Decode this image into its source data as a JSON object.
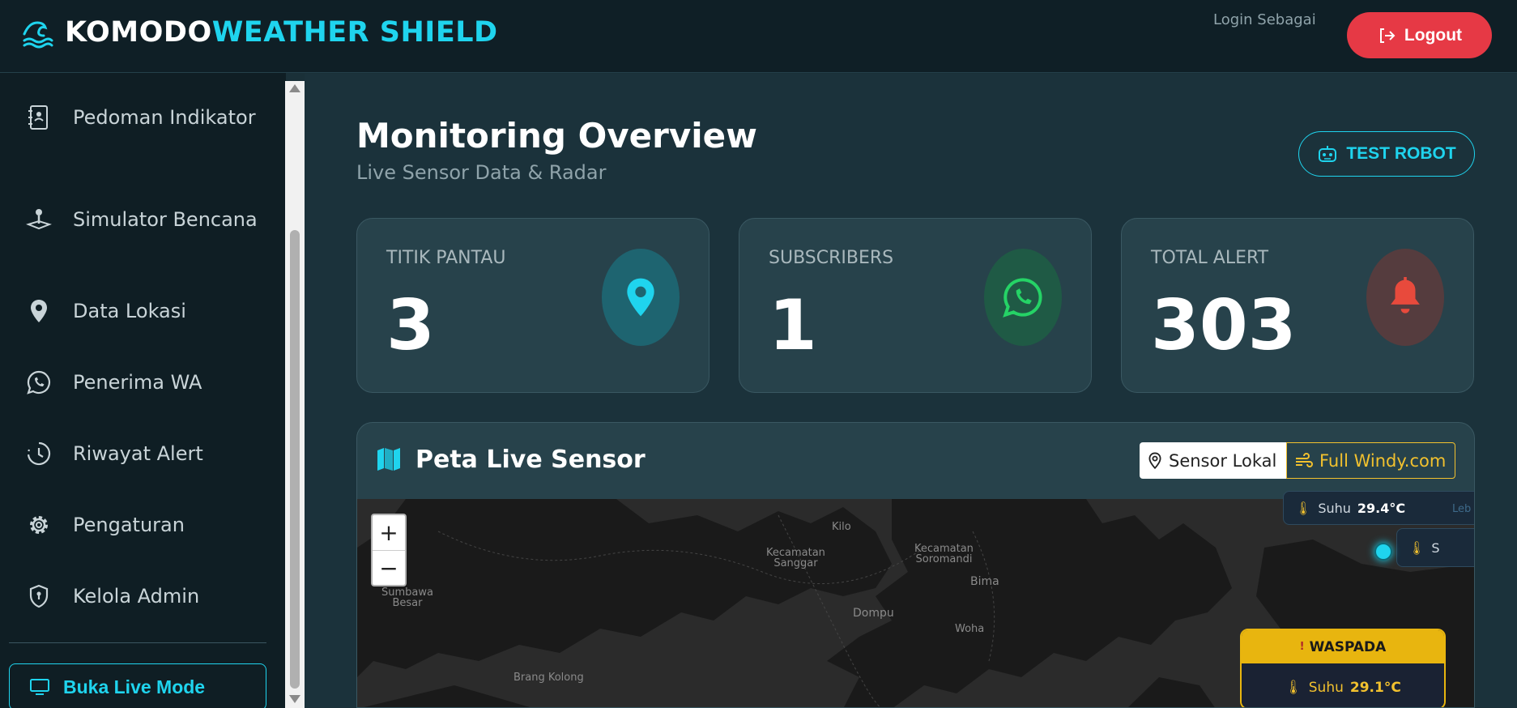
{
  "header": {
    "brand_part1": "KOMODO",
    "brand_part2": "WEATHER SHIELD",
    "login_as": "Login Sebagai",
    "logout_label": "Logout"
  },
  "sidebar": {
    "items": [
      {
        "label": "Pedoman Indikator",
        "icon": "address-book-icon"
      },
      {
        "label": "Simulator Bencana",
        "icon": "joystick-icon"
      },
      {
        "label": "Data Lokasi",
        "icon": "map-pin-icon"
      },
      {
        "label": "Penerima WA",
        "icon": "whatsapp-icon"
      },
      {
        "label": "Riwayat Alert",
        "icon": "clock-history-icon"
      },
      {
        "label": "Pengaturan",
        "icon": "gear-icon"
      },
      {
        "label": "Kelola Admin",
        "icon": "shield-icon"
      }
    ],
    "live_mode_label": "Buka Live Mode"
  },
  "main": {
    "title": "Monitoring Overview",
    "subtitle": "Live Sensor Data & Radar",
    "test_robot_label": "TEST ROBOT",
    "cards": [
      {
        "label": "TITIK PANTAU",
        "value": "3",
        "icon": "map-pin-icon",
        "badge_color": "#1e6470",
        "icon_color": "#1fd4ee"
      },
      {
        "label": "SUBSCRIBERS",
        "value": "1",
        "icon": "whatsapp-icon",
        "badge_color": "#1f5a45",
        "icon_color": "#25d366"
      },
      {
        "label": "TOTAL ALERT",
        "value": "303",
        "icon": "bell-icon",
        "badge_color": "#553c3e",
        "icon_color": "#e84a3c"
      }
    ],
    "map": {
      "title": "Peta Live Sensor",
      "sensor_lokal_label": "Sensor Lokal",
      "full_windy_label": "Full Windy.com",
      "zoom_in": "+",
      "zoom_out": "−",
      "places": {
        "kilo": "Kilo",
        "sanggar": "Kecamatan\nSanggar",
        "soromandi": "Kecamatan\nSoromandi",
        "bima": "Bima",
        "sumbawa_besar": "Sumbawa\nBesar",
        "dompu": "Dompu",
        "woha": "Woha",
        "brang_kolong": "Brang Kolong"
      },
      "popup1": {
        "label": "Suhu",
        "value": "29.4°C"
      },
      "popup1_extra": "Leb",
      "popup2": {
        "label": "S"
      },
      "waspada": {
        "status": "WASPADA",
        "label": "Suhu",
        "value": "29.1°C"
      }
    }
  },
  "colors": {
    "accent": "#1fd4ee",
    "logout": "#e63945",
    "warning": "#e8b50f"
  }
}
